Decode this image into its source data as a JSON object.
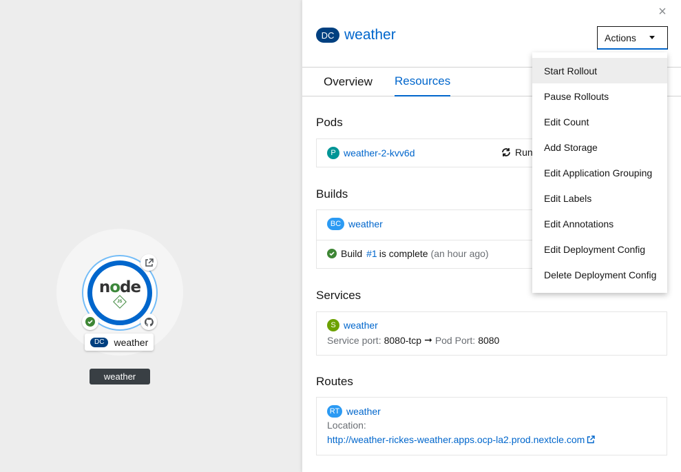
{
  "topology": {
    "node_kind_badge": "DC",
    "node_name": "weather",
    "group_label": "weather",
    "node_logo_text": "node",
    "node_logo_sub": "JS"
  },
  "panel": {
    "close_icon": "×",
    "kind_badge": "DC",
    "title": "weather",
    "actions_label": "Actions",
    "tabs": [
      {
        "label": "Overview",
        "selected": false
      },
      {
        "label": "Resources",
        "selected": true
      }
    ],
    "pods": {
      "section_title": "Pods",
      "items": [
        {
          "badge": "P",
          "name": "weather-2-kvv6d",
          "status": "Running"
        }
      ]
    },
    "builds": {
      "section_title": "Builds",
      "config_badge": "BC",
      "config_name": "weather",
      "build_prefix": "Build",
      "build_number": "#1",
      "build_status": "is complete",
      "build_time": "(an hour ago)"
    },
    "services": {
      "section_title": "Services",
      "badge": "S",
      "name": "weather",
      "service_port_label": "Service port:",
      "service_port": "8080-tcp",
      "arrow": "➞",
      "pod_port_label": "Pod Port:",
      "pod_port": "8080"
    },
    "routes": {
      "section_title": "Routes",
      "badge": "RT",
      "name": "weather",
      "location_label": "Location:",
      "url": "http://weather-rickes-weather.apps.ocp-la2.prod.nextcle.com"
    }
  },
  "actions_menu": {
    "items": [
      {
        "label": "Start Rollout",
        "highlighted": true
      },
      {
        "label": "Pause Rollouts",
        "highlighted": false
      },
      {
        "label": "Edit Count",
        "highlighted": false
      },
      {
        "label": "Add Storage",
        "highlighted": false
      },
      {
        "label": "Edit Application Grouping",
        "highlighted": false
      },
      {
        "label": "Edit Labels",
        "highlighted": false
      },
      {
        "label": "Edit Annotations",
        "highlighted": false
      },
      {
        "label": "Edit Deployment Config",
        "highlighted": false
      },
      {
        "label": "Delete Deployment Config",
        "highlighted": false
      }
    ]
  },
  "colors": {
    "accent": "#0066cc",
    "success": "#3e8635",
    "dc_badge": "#004080",
    "pod_badge": "#009596",
    "svc_badge": "#6ca100",
    "rt_badge": "#2b9af3"
  }
}
